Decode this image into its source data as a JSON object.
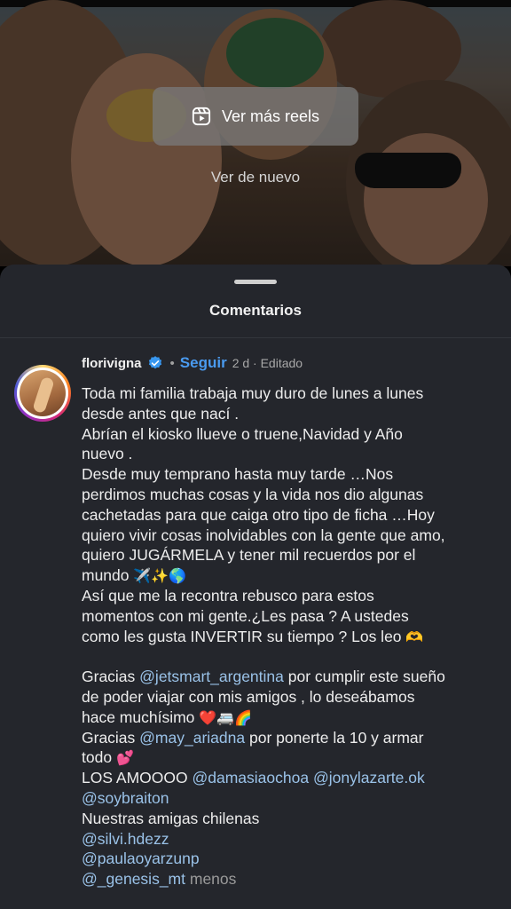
{
  "reel": {
    "more_reels_label": "Ver más reels",
    "watch_again_label": "Ver de nuevo"
  },
  "comments": {
    "title": "Comentarios",
    "post": {
      "username": "florivigna",
      "verified": true,
      "follow_label": "Seguir",
      "separator": "•",
      "meta": "2 d · Editado",
      "lines": [
        "Toda mi familia trabaja muy  duro de lunes a lunes",
        "desde antes que nací .",
        "Abrían el kiosko llueve o truene,Navidad y Año",
        "nuevo .",
        "Desde muy temprano hasta muy tarde …Nos",
        "perdimos muchas cosas y la vida nos dio algunas",
        "cachetadas para que caiga otro tipo de  ficha …Hoy",
        "quiero vivir cosas inolvidables con la gente que amo,",
        "quiero JUGÁRMELA y tener mil recuerdos por el",
        "mundo",
        "Así que me la recontra rebusco para estos",
        "momentos con mi gente.¿Les pasa ? A ustedes",
        "como les gusta INVERTIR su tiempo ? Los leo",
        "Gracias",
        "por cumplir este sueño",
        "de poder viajar con mis amigos , lo deseábamos",
        "hace muchísimo",
        "Gracias",
        "por ponerte la 10 y armar",
        "todo",
        "LOS AMOOOO",
        "Nuestras amigas chilenas"
      ],
      "mentions": {
        "jetsmart": "@jetsmart_argentina",
        "may": "@may_ariadna",
        "damasia": "@damasiaochoa",
        "jony": "@jonylazarte.ok",
        "soybraiton": "@soybraiton",
        "silvi": "@silvi.hdezz",
        "paula": "@paulaoyarzunp",
        "genesis": "@_genesis_mt"
      },
      "emojis": {
        "travel": "✈️✨🌎",
        "heart_hands": "🫶",
        "love_trip": "❤️🚐🌈",
        "hearts": "💕"
      },
      "less_label": "menos"
    }
  },
  "colors": {
    "sheet_bg": "#24262c",
    "follow_blue": "#4a9bf0",
    "mention_blue": "#9ac2e8",
    "verified_blue": "#3897f0"
  }
}
